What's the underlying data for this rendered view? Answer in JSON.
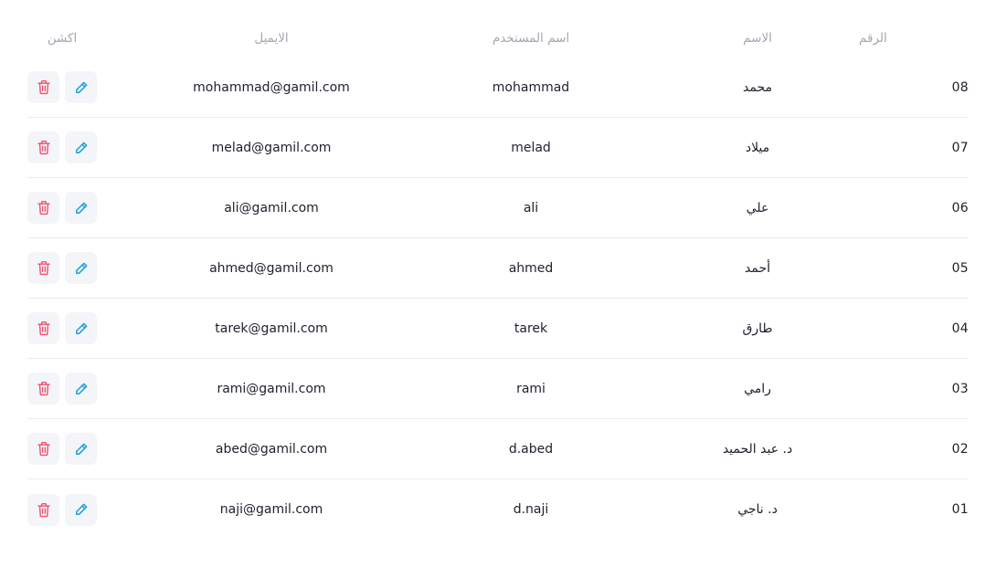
{
  "headers": {
    "number": "الرقم",
    "name": "الاسم",
    "username": "اسم المستخدم",
    "email": "الايميل",
    "action": "اكشن"
  },
  "rows": [
    {
      "number": "08",
      "name": "محمد",
      "username": "mohammad",
      "email": "mohammad@gamil.com"
    },
    {
      "number": "07",
      "name": "ميلاد",
      "username": "melad",
      "email": "melad@gamil.com"
    },
    {
      "number": "06",
      "name": "علي",
      "username": "ali",
      "email": "ali@gamil.com"
    },
    {
      "number": "05",
      "name": "أحمد",
      "username": "ahmed",
      "email": "ahmed@gamil.com"
    },
    {
      "number": "04",
      "name": "طارق",
      "username": "tarek",
      "email": "tarek@gamil.com"
    },
    {
      "number": "03",
      "name": "رامي",
      "username": "rami",
      "email": "rami@gamil.com"
    },
    {
      "number": "02",
      "name": "د. عبد الحميد",
      "username": "d.abed",
      "email": "abed@gamil.com"
    },
    {
      "number": "01",
      "name": "د. ناجي",
      "username": "d.naji",
      "email": "naji@gamil.com"
    }
  ],
  "icons": {
    "edit": "pencil-icon",
    "delete": "trash-icon"
  },
  "colors": {
    "edit_icon": "#1a9fe0",
    "delete_icon": "#f0506e",
    "button_bg": "#f4f5f8",
    "header_text": "#a6a6b3",
    "divider": "#ececf0"
  }
}
